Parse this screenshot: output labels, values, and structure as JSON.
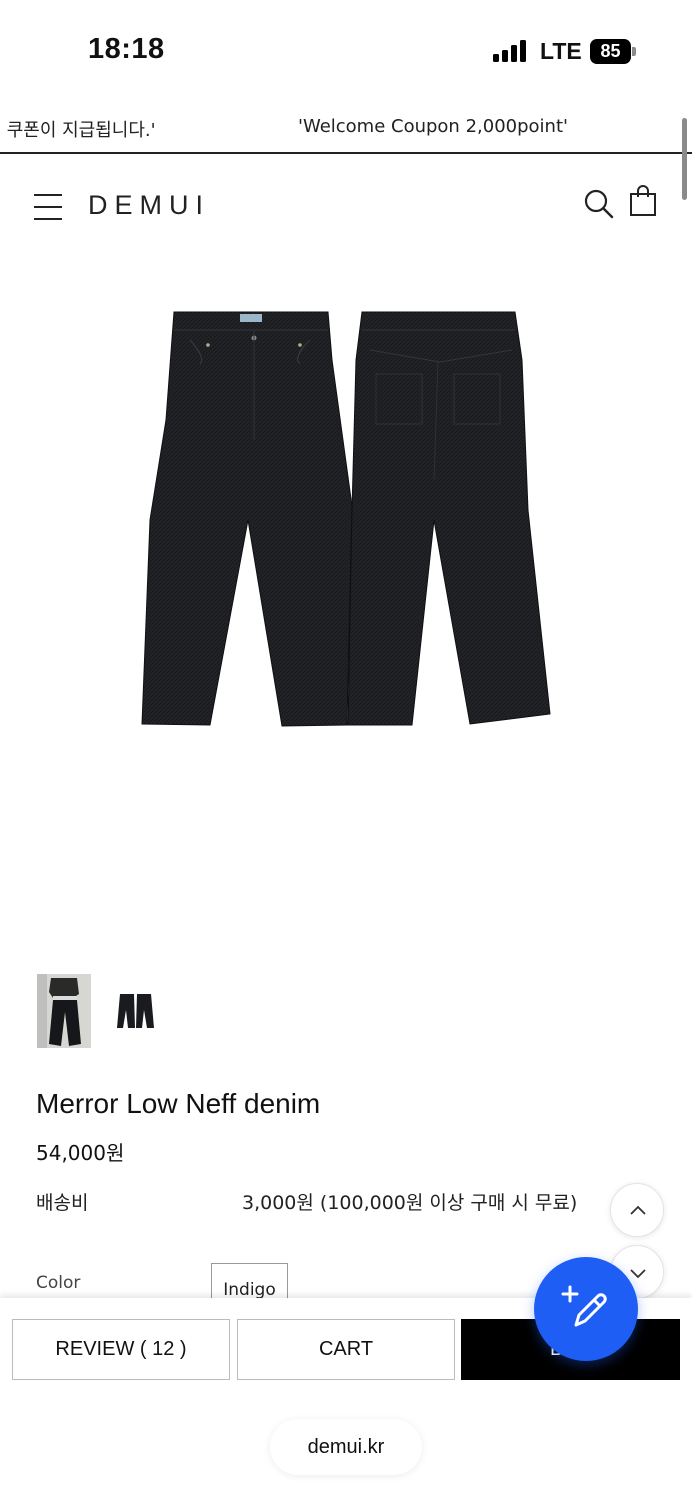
{
  "status_bar": {
    "time": "18:18",
    "network": "LTE",
    "battery": "85"
  },
  "banner": {
    "items": [
      "l 쿠폰이 지급됩니다.'",
      "'Welcome Coupon 2,000point'"
    ]
  },
  "header": {
    "logo": "DEMUI",
    "menu_icon": "hamburger-icon",
    "search_icon": "search-icon",
    "bag_icon": "shopping-bag-icon"
  },
  "product": {
    "name": "Merror Low Neff denim",
    "price": "54,000원",
    "shipping_label": "배송비",
    "shipping_value": "3,000원 (100,000원 이상 구매 시 무료)",
    "color_label": "Color",
    "color_option": "Indigo",
    "thumbnails": [
      "model-photo",
      "pants-flat"
    ]
  },
  "actions": {
    "review": "REVIEW ( 12 )",
    "cart": "CART",
    "buy": "BUY"
  },
  "browser": {
    "url": "demui.kr"
  },
  "colors": {
    "accent_blue": "#1f5ef5",
    "denim": "#1b1c1f",
    "buy_button": "#000000"
  }
}
